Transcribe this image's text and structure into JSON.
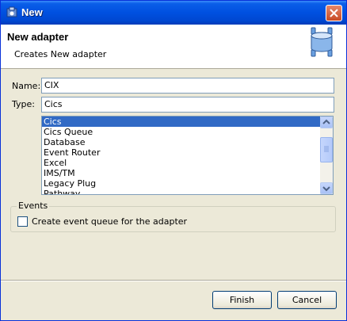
{
  "window": {
    "title": "New"
  },
  "header": {
    "title": "New adapter",
    "subtitle": "Creates New adapter",
    "icon": "adapter-icon"
  },
  "form": {
    "name_label": "Name:",
    "name_value": "CIX",
    "type_label": "Type:",
    "type_value": "Cics",
    "type_options": [
      "Cics",
      "Cics Queue",
      "Database",
      "Event Router",
      "Excel",
      "IMS/TM",
      "Legacy Plug",
      "Pathway"
    ],
    "selected_type": "Cics"
  },
  "events": {
    "group_label": "Events",
    "checkbox_label": "Create event queue for the adapter",
    "checked": false
  },
  "buttons": {
    "finish": "Finish",
    "cancel": "Cancel"
  },
  "colors": {
    "titlebar": "#0050e0",
    "selection": "#316ac5",
    "dialog": "#ece9d8"
  }
}
